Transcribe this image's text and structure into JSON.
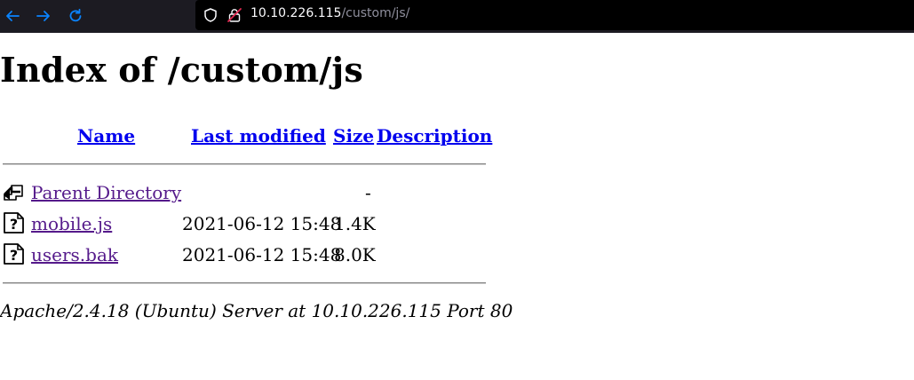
{
  "browser": {
    "url_host": "10.10.226.115",
    "url_path": "/custom/js/",
    "icons": [
      "back-icon",
      "forward-icon",
      "reload-icon",
      "shield-icon",
      "insecure-lock-icon"
    ],
    "colors": {
      "toolbar": "#1c1b22",
      "urlbar": "#000000",
      "nav_icon": "#0a84ff"
    }
  },
  "page": {
    "title": "Index of /custom/js",
    "columns": {
      "name": "Name",
      "last_modified": "Last modified",
      "size": "Size",
      "description": "Description"
    },
    "rows": [
      {
        "icon": "back-folder-icon",
        "name": "Parent Directory",
        "last_modified": "",
        "size": "-",
        "description": ""
      },
      {
        "icon": "unknown-file-icon",
        "name": "mobile.js",
        "last_modified": "2021-06-12 15:48",
        "size": "1.4K",
        "description": ""
      },
      {
        "icon": "unknown-file-icon",
        "name": "users.bak",
        "last_modified": "2021-06-12 15:48",
        "size": "8.0K",
        "description": ""
      }
    ],
    "footer": "Apache/2.4.18 (Ubuntu) Server at 10.10.226.115 Port 80",
    "colors": {
      "link": "#0000ee",
      "visited_link": "#551a8b"
    }
  }
}
